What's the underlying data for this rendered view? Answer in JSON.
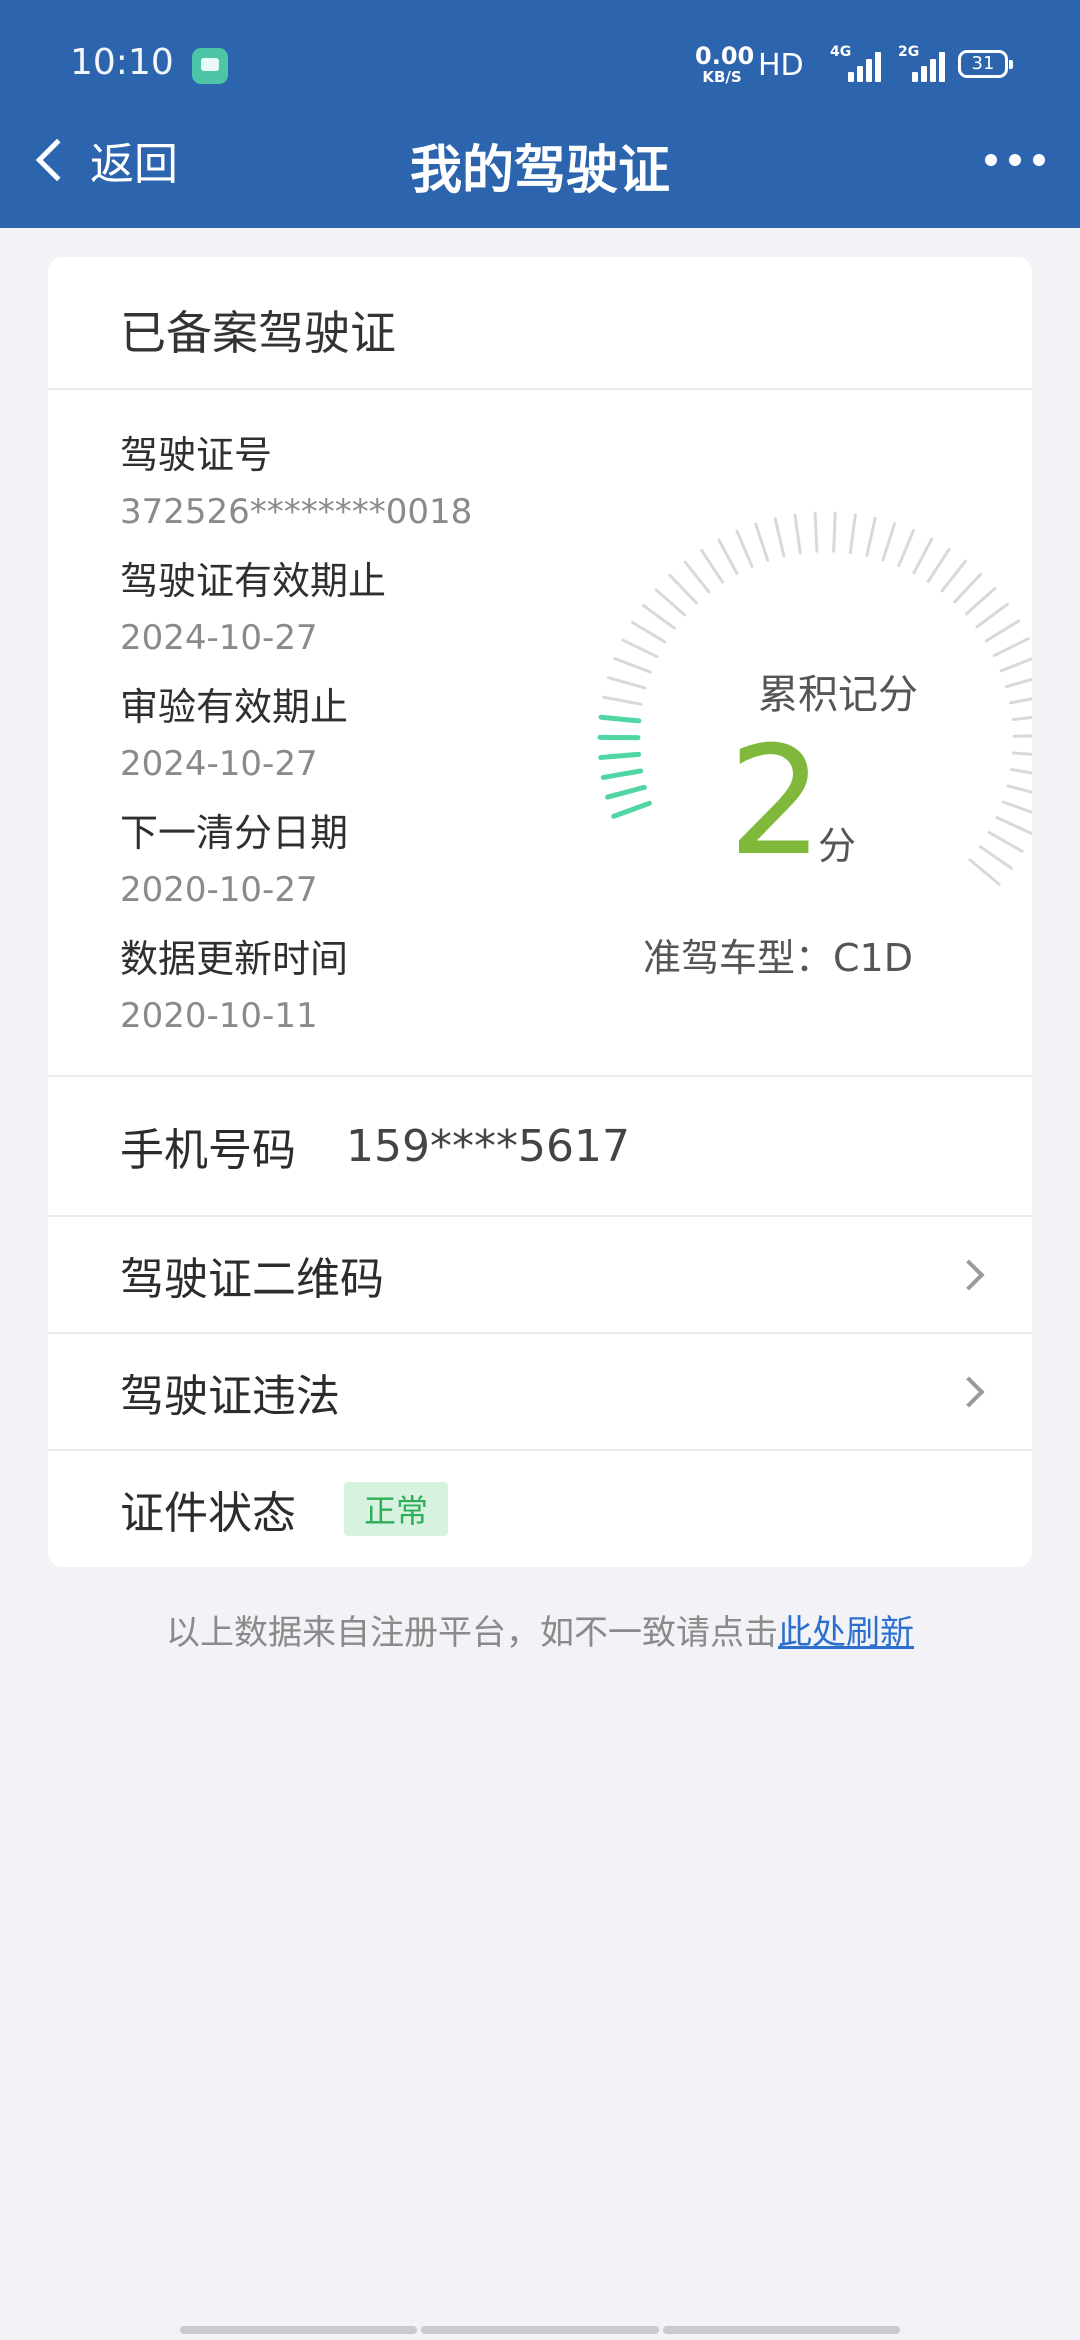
{
  "status_bar": {
    "time": "10:10",
    "net_speed_value": "0.00",
    "net_speed_unit": "KB/S",
    "hd": "HD",
    "signal1": "4G",
    "signal2": "2G",
    "battery": "31"
  },
  "header": {
    "back_label": "返回",
    "title": "我的驾驶证",
    "more_icon": "more-icon"
  },
  "card": {
    "title": "已备案驾驶证",
    "fields": [
      {
        "label": "驾驶证号",
        "value": "372526********0018"
      },
      {
        "label": "驾驶证有效期止",
        "value": "2024-10-27"
      },
      {
        "label": "审验有效期止",
        "value": "2024-10-27"
      },
      {
        "label": "下一清分日期",
        "value": "2020-10-27"
      },
      {
        "label": "数据更新时间",
        "value": "2020-10-11"
      }
    ],
    "gauge": {
      "label": "累积记分",
      "score": "2",
      "unit": "分",
      "max_score": 12,
      "active_color": "#4fd6a3",
      "inactive_color": "#d9d9d9"
    },
    "license_class": "准驾车型：C1D",
    "phone": {
      "label": "手机号码",
      "value": "159****5617"
    },
    "qr_row": {
      "label": "驾驶证二维码"
    },
    "violation_row": {
      "label": "驾驶证违法"
    },
    "status_row": {
      "label": "证件状态",
      "tag": "正常"
    }
  },
  "footer": {
    "note": "以上数据来自注册平台，如不一致请点击",
    "link": "此处刷新"
  },
  "colors": {
    "header_bg": "#2c64ad",
    "score_color": "#7fb83a",
    "link_color": "#2c6fcf"
  }
}
